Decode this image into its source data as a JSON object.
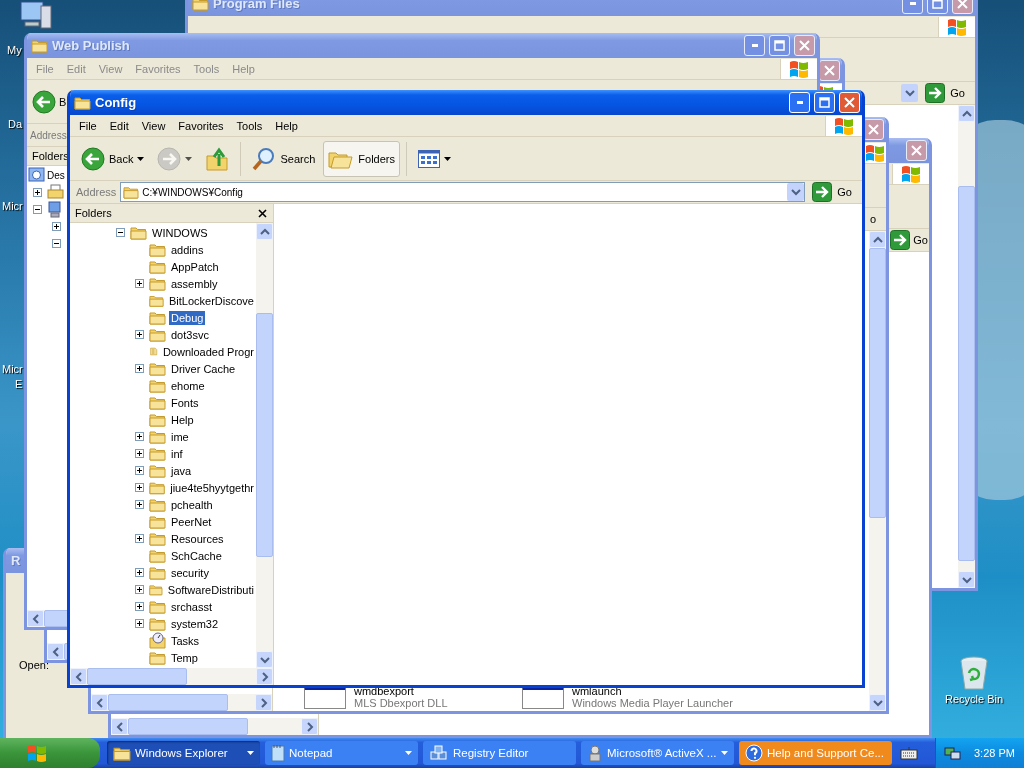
{
  "desktop": {
    "icons": [
      {
        "kind": "computer",
        "label": "My"
      },
      {
        "kind": "label_only",
        "label": "Da"
      },
      {
        "kind": "label_only",
        "label": "Micr"
      },
      {
        "kind": "label_only",
        "label": "Micr",
        "second_line": "E"
      },
      {
        "kind": "recycle_bin",
        "label": "Recycle Bin"
      }
    ]
  },
  "windows": [
    {
      "kind": "explorer",
      "title": "Program Files",
      "active": false,
      "go": "Go"
    },
    {
      "kind": "run",
      "title": "R",
      "active": false,
      "open_label": "Open:"
    },
    {
      "kind": "explorer",
      "active": false,
      "go": "Go"
    },
    {
      "kind": "explorer",
      "active": false,
      "go": "o",
      "items": [
        {
          "name": "wmdbexport",
          "description": "MLS Dbexport DLL"
        },
        {
          "name": "wmlaunch",
          "description": "Windows Media Player Launcher"
        }
      ]
    },
    {
      "kind": "explorer",
      "active": false
    },
    {
      "kind": "explorer",
      "title": "Web Publish",
      "active": false,
      "menu": [
        "File",
        "Edit",
        "View",
        "Favorites",
        "Tools",
        "Help"
      ],
      "back": "B",
      "address_label": "Address",
      "folders_label": "Folders",
      "tree": [
        {
          "kind": "desktop",
          "label": "Des",
          "expandable": false,
          "children": [
            {
              "kind": "printer",
              "expandable": true,
              "expanded": false
            },
            {
              "kind": "computer",
              "expandable": true,
              "expanded": true,
              "children": [
                {
                  "expandable": true,
                  "expanded": false
                },
                {
                  "expandable": true,
                  "expanded": true
                }
              ]
            }
          ]
        }
      ]
    }
  ],
  "explorer": {
    "title": "Config",
    "active": true,
    "menu": [
      "File",
      "Edit",
      "View",
      "Favorites",
      "Tools",
      "Help"
    ],
    "toolbar": [
      {
        "kind": "back",
        "label": "Back",
        "dropdown": true,
        "disabled": false,
        "selected": false
      },
      {
        "kind": "forward",
        "dropdown": true,
        "disabled": true,
        "selected": false
      },
      {
        "kind": "up",
        "dropdown": false,
        "disabled": false,
        "selected": false
      },
      {
        "kind": "search",
        "label": "Search",
        "dropdown": false,
        "disabled": false,
        "selected": false
      },
      {
        "kind": "folders",
        "label": "Folders",
        "dropdown": false,
        "disabled": false,
        "selected": true
      },
      {
        "kind": "views",
        "dropdown": true,
        "disabled": false,
        "selected": false
      }
    ],
    "address": {
      "label": "Address",
      "value": "C:¥WINDOWS¥Config",
      "go": "Go"
    },
    "folders_pane": {
      "title": "Folders"
    },
    "tree": [
      {
        "kind": "folder",
        "label": "WINDOWS",
        "expandable": true,
        "expanded": true,
        "selected": false,
        "children": [
          {
            "kind": "folder",
            "label": "addins",
            "expandable": false,
            "selected": false
          },
          {
            "kind": "folder",
            "label": "AppPatch",
            "expandable": false,
            "selected": false
          },
          {
            "kind": "folder",
            "label": "assembly",
            "expandable": true,
            "expanded": false,
            "selected": false
          },
          {
            "kind": "folder",
            "label": "BitLockerDiscove",
            "expandable": false,
            "selected": false
          },
          {
            "kind": "folder",
            "label": "Debug",
            "expandable": false,
            "selected": true
          },
          {
            "kind": "folder",
            "label": "dot3svc",
            "expandable": true,
            "expanded": false,
            "selected": false
          },
          {
            "kind": "download",
            "label": "Downloaded Progr",
            "expandable": false,
            "selected": false
          },
          {
            "kind": "folder",
            "label": "Driver Cache",
            "expandable": true,
            "expanded": false,
            "selected": false
          },
          {
            "kind": "folder",
            "label": "ehome",
            "expandable": false,
            "selected": false
          },
          {
            "kind": "folder",
            "label": "Fonts",
            "expandable": false,
            "selected": false
          },
          {
            "kind": "folder",
            "label": "Help",
            "expandable": false,
            "selected": false
          },
          {
            "kind": "folder",
            "label": "ime",
            "expandable": true,
            "expanded": false,
            "selected": false
          },
          {
            "kind": "folder",
            "label": "inf",
            "expandable": true,
            "expanded": false,
            "selected": false
          },
          {
            "kind": "folder",
            "label": "java",
            "expandable": true,
            "expanded": false,
            "selected": false
          },
          {
            "kind": "folder",
            "label": "jiue4te5hyytgethr",
            "expandable": true,
            "expanded": false,
            "selected": false
          },
          {
            "kind": "folder",
            "label": "pchealth",
            "expandable": true,
            "expanded": false,
            "selected": false
          },
          {
            "kind": "folder",
            "label": "PeerNet",
            "expandable": false,
            "selected": false
          },
          {
            "kind": "folder",
            "label": "Resources",
            "expandable": true,
            "expanded": false,
            "selected": false
          },
          {
            "kind": "folder",
            "label": "SchCache",
            "expandable": false,
            "selected": false
          },
          {
            "kind": "folder",
            "label": "security",
            "expandable": true,
            "expanded": false,
            "selected": false
          },
          {
            "kind": "folder",
            "label": "SoftwareDistributi",
            "expandable": true,
            "expanded": false,
            "selected": false
          },
          {
            "kind": "folder",
            "label": "srchasst",
            "expandable": true,
            "expanded": false,
            "selected": false
          },
          {
            "kind": "folder",
            "label": "system32",
            "expandable": true,
            "expanded": false,
            "selected": false
          },
          {
            "kind": "tasks",
            "label": "Tasks",
            "expandable": false,
            "selected": false
          },
          {
            "kind": "folder",
            "label": "Temp",
            "expandable": false,
            "selected": false
          }
        ]
      }
    ]
  },
  "taskbar": {
    "buttons": [
      {
        "kind": "folder",
        "label": "Windows Explorer",
        "grouped": true,
        "selected": true,
        "flashing": false
      },
      {
        "kind": "notepad",
        "label": "Notepad",
        "grouped": true,
        "selected": false,
        "flashing": false
      },
      {
        "kind": "registry",
        "label": "Registry Editor",
        "grouped": false,
        "selected": false,
        "flashing": false
      },
      {
        "kind": "activex",
        "label": "Microsoft® ActiveX ...",
        "grouped": true,
        "selected": false,
        "flashing": false
      },
      {
        "kind": "help",
        "label": "Help and Support Ce...",
        "grouped": false,
        "selected": false,
        "flashing": true
      }
    ],
    "clock": "3:28 PM"
  }
}
